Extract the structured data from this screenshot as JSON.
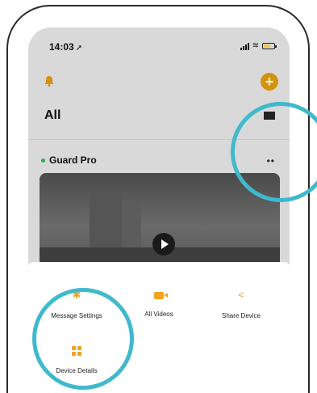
{
  "status_bar": {
    "time": "14:03",
    "location_arrow": "➚",
    "wifi_icon": "wifi-icon",
    "battery_level": 0.5
  },
  "header": {
    "title": "All",
    "bell_icon": "bell-icon",
    "add_icon": "plus-icon",
    "add_label": "+"
  },
  "device": {
    "name": "Guard Pro",
    "status_color": "#2eab4e",
    "more_label": "••"
  },
  "actions": [
    {
      "label": "Message Settings",
      "icon": "gear-icon",
      "glyph": "✱"
    },
    {
      "label": "All Videos",
      "icon": "video-camera-icon"
    },
    {
      "label": "Share Device",
      "icon": "share-icon",
      "glyph": "<"
    },
    {
      "label": "Device Details",
      "icon": "grid-icon"
    }
  ],
  "colors": {
    "accent": "#f2a21e",
    "highlight_ring": "#3fb9cc"
  }
}
